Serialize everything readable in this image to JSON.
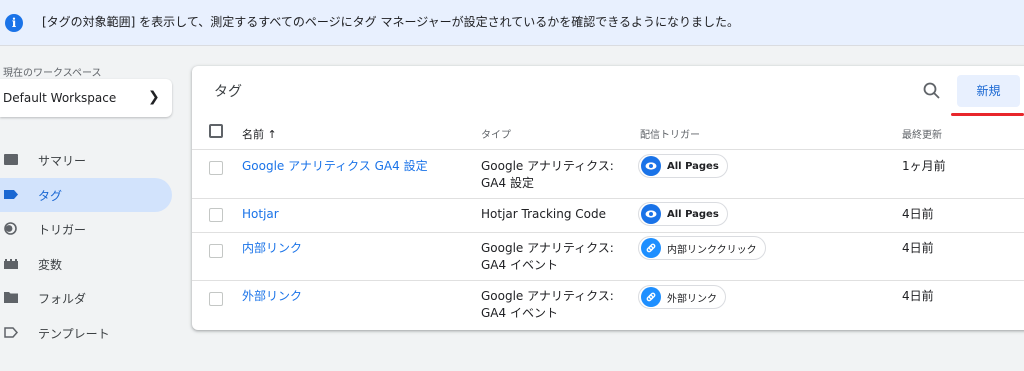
{
  "banner": {
    "message": "[タグの対象範囲] を表示して、測定するすべてのページにタグ マネージャーが設定されているかを確認できるようになりました。"
  },
  "workspace": {
    "label": "現在のワークスペース",
    "name": "Default Workspace"
  },
  "nav": {
    "items": [
      {
        "label": "サマリー",
        "icon": "summary-icon"
      },
      {
        "label": "タグ",
        "icon": "tag-icon",
        "active": true
      },
      {
        "label": "トリガー",
        "icon": "trigger-icon"
      },
      {
        "label": "変数",
        "icon": "variables-icon"
      },
      {
        "label": "フォルダ",
        "icon": "folder-icon"
      },
      {
        "label": "テンプレート",
        "icon": "template-icon"
      }
    ]
  },
  "card": {
    "title": "タグ",
    "new_label": "新規",
    "columns": {
      "name": "名前 ↑",
      "type": "タイプ",
      "trigger": "配信トリガー",
      "updated": "最終更新"
    },
    "rows": [
      {
        "name": "Google アナリティクス GA4 設定",
        "type_line1": "Google アナリティクス:",
        "type_line2": "GA4 設定",
        "trigger": "All Pages",
        "trigger_icon": "eye-icon",
        "updated": "1ヶ月前"
      },
      {
        "name": "Hotjar",
        "type_line1": "Hotjar Tracking Code",
        "type_line2": "",
        "trigger": "All Pages",
        "trigger_icon": "eye-icon",
        "updated": "4日前"
      },
      {
        "name": "内部リンク",
        "type_line1": "Google アナリティクス:",
        "type_line2": "GA4 イベント",
        "trigger": "内部リンククリック",
        "trigger_icon": "link-icon",
        "updated": "4日前"
      },
      {
        "name": "外部リンク",
        "type_line1": "Google アナリティクス:",
        "type_line2": "GA4 イベント",
        "trigger": "外部リンク",
        "trigger_icon": "link-icon",
        "updated": "4日前"
      }
    ]
  },
  "colors": {
    "accent": "#1a73e8",
    "highlight": "#e8262b"
  }
}
